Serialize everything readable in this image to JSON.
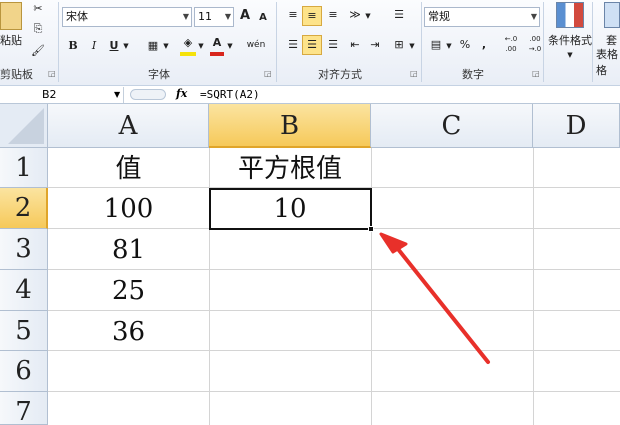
{
  "ribbon": {
    "clipboard": {
      "paste_label": "粘贴",
      "group_label": "剪贴板"
    },
    "font": {
      "name": "宋体",
      "size": "11",
      "group_label": "字体",
      "grow_label": "A",
      "shrink_label": "A",
      "bold": "B",
      "italic": "I",
      "underline": "U",
      "font_color": "A",
      "phonetic": "wén"
    },
    "alignment": {
      "group_label": "对齐方式"
    },
    "number": {
      "format": "常规",
      "group_label": "数字",
      "percent": "%",
      "comma": ",",
      "inc_decimal": "←.0 .00",
      "dec_decimal": ".00 →.0"
    },
    "styles": {
      "conditional_format_label": "条件格式",
      "table_format_label_top": "套",
      "table_format_label_bottom": "表格格"
    }
  },
  "formula_bar": {
    "name_box": "B2",
    "fx_label": "fx",
    "formula": "=SQRT(A2)"
  },
  "columns": [
    "A",
    "B",
    "C",
    "D"
  ],
  "rows": [
    "1",
    "2",
    "3",
    "4",
    "5",
    "6",
    "7"
  ],
  "cells": {
    "A1": "值",
    "B1": "平方根值",
    "A2": "100",
    "B2": "10",
    "A3": "81",
    "A4": "25",
    "A5": "36"
  },
  "colors": {
    "selection": "#f6c95a",
    "annotation_arrow": "#e8302a"
  }
}
